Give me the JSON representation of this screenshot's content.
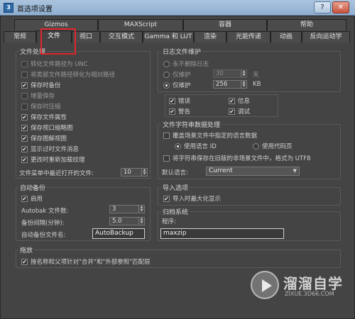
{
  "window": {
    "title": "首选项设置",
    "help_btn": "?",
    "close_btn": "✕"
  },
  "tabs_row1": [
    "Gizmos",
    "MAXScript",
    "容器",
    "帮助"
  ],
  "tabs_row2": [
    "常规",
    "文件",
    "视口",
    "交互模式",
    "Gamma 和 LUT",
    "渲染",
    "光能传递",
    "动画",
    "反向运动学"
  ],
  "file_handling": {
    "label": "文件处理",
    "items": [
      {
        "label": "转化文件路径为 UNC",
        "checked": false,
        "enabled": false
      },
      {
        "label": "将类部文件路径转化为相对路径",
        "checked": false,
        "enabled": false
      },
      {
        "label": "保存时备份",
        "checked": true,
        "enabled": true
      },
      {
        "label": "增量保存",
        "checked": false,
        "enabled": false
      },
      {
        "label": "保存时压缩",
        "checked": false,
        "enabled": false
      },
      {
        "label": "保存文件属性",
        "checked": true,
        "enabled": true
      },
      {
        "label": "保存视口缩略图",
        "checked": true,
        "enabled": true
      },
      {
        "label": "保存图解视图",
        "checked": true,
        "enabled": true
      },
      {
        "label": "显示过时文件消息",
        "checked": true,
        "enabled": true
      },
      {
        "label": "更改时重新加载纹理",
        "checked": true,
        "enabled": true
      }
    ],
    "recent_label": "文件菜单中最近打开的文件:",
    "recent_value": "10"
  },
  "log_maint": {
    "label": "日志文件维护",
    "never_delete": "永不删除日志",
    "keep_label": "仅维护",
    "keep_days": "30",
    "days_unit": "天",
    "keep_kb": "256",
    "kb_unit": "KB",
    "flags": [
      {
        "label": "错误",
        "checked": true
      },
      {
        "label": "信息",
        "checked": true
      },
      {
        "label": "警告",
        "checked": true
      },
      {
        "label": "调试",
        "checked": true
      }
    ]
  },
  "string_handling": {
    "label": "文件字符串数据处理",
    "override": "覆盖场景文件中指定的语言数据",
    "use_lang_id": "使用语言 ID",
    "use_codepage": "使用代码页",
    "utf8": "将字符串保存在旧版的非场景文件中，格式为 UTF8",
    "default_lang_label": "默认语言:",
    "default_lang_value": "Current"
  },
  "auto_backup": {
    "label": "自动备份",
    "enable": "启用",
    "count_label": "Autobak 文件数:",
    "count_value": "3",
    "interval_label": "备份间隔(分钟):",
    "interval_value": "5.0",
    "name_label": "自动备份文件名:",
    "name_value": "AutoBackup"
  },
  "import_opts": {
    "label": "导入选项",
    "maximize": "导入时最大化显示"
  },
  "archive": {
    "label": "归档系统",
    "program_label": "程序:",
    "program_value": "maxzip"
  },
  "xref": {
    "label": "拖放",
    "match": "按名称和父项针对\"合并\"和\"外部参照\"匹配层"
  },
  "watermark": {
    "title": "溜溜自学",
    "sub": "ZIXUE.3D66.COM"
  },
  "colors": {
    "accent": "#e0252b",
    "panel": "#444444"
  }
}
